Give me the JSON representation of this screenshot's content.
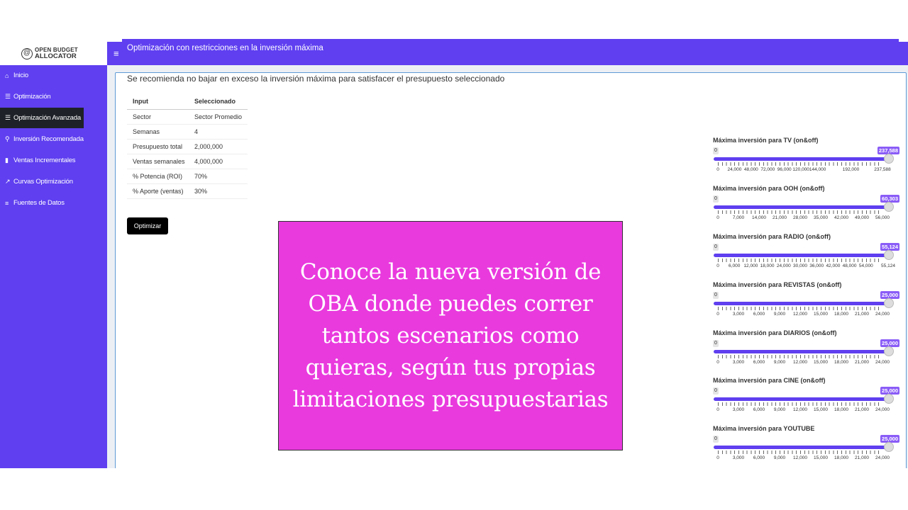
{
  "sidebar": {
    "logo_line1": "OPEN BUDGET",
    "logo_line2": "ALLOCATOR",
    "items": [
      {
        "label": "Inicio",
        "icon": "home-icon"
      },
      {
        "label": "Optimización",
        "icon": "sliders-icon"
      },
      {
        "label": "Optimización Avanzada",
        "icon": "sliders-icon"
      },
      {
        "label": "Inversión Recomendada",
        "icon": "search-icon"
      },
      {
        "label": "Ventas Incrementales",
        "icon": "bar-chart-icon"
      },
      {
        "label": "Curvas Optimización",
        "icon": "line-chart-icon"
      },
      {
        "label": "Fuentes de Datos",
        "icon": "database-icon"
      }
    ],
    "active_item": "Optimización Avanzada"
  },
  "header": {
    "menu_icon": "hamburger-icon"
  },
  "main": {
    "box_title": "Optimización con restricciones en la inversión máxima",
    "recommendation": "Se recomienda no bajar en exceso la inversión máxima para satisfacer el presupuesto seleccionado",
    "table": {
      "headers": [
        "Input",
        "Seleccionado"
      ],
      "rows": [
        [
          "Sector",
          "Sector Promedio"
        ],
        [
          "Semanas",
          "4"
        ],
        [
          "Presupuesto total",
          "2,000,000"
        ],
        [
          "Ventas semanales",
          "4,000,000"
        ],
        [
          "% Potencia (ROI)",
          "70%"
        ],
        [
          "% Aporte (ventas)",
          "30%"
        ]
      ]
    },
    "optimize_button": "Optimizar"
  },
  "sliders": [
    {
      "label": "Máxima inversión para TV (on&off)",
      "min": "0",
      "value": "237,588",
      "level": 1.0,
      "ticks": [
        "0",
        "24,000",
        "48,000",
        "72,000",
        "96,000",
        "120,000",
        "144,000",
        "192,000",
        "237,588"
      ]
    },
    {
      "label": "Máxima inversión para OOH (on&off)",
      "min": "0",
      "value": "60,303",
      "level": 1.0,
      "ticks": [
        "0",
        "7,000",
        "14,000",
        "21,000",
        "28,000",
        "35,000",
        "42,000",
        "49,000",
        "56,000"
      ]
    },
    {
      "label": "Máxima inversión para RADIO (on&off)",
      "min": "0",
      "value": "55,124",
      "level": 1.0,
      "ticks": [
        "0",
        "6,000",
        "12,000",
        "18,000",
        "24,000",
        "30,000",
        "36,000",
        "42,000",
        "48,000",
        "54,000",
        "55,124"
      ]
    },
    {
      "label": "Máxima inversión para REVISTAS (on&off)",
      "min": "0",
      "value": "25,000",
      "level": 1.0,
      "ticks": [
        "0",
        "3,000",
        "6,000",
        "9,000",
        "12,000",
        "15,000",
        "18,000",
        "21,000",
        "24,000"
      ]
    },
    {
      "label": "Máxima inversión para DIARIOS (on&off)",
      "min": "0",
      "value": "25,000",
      "level": 1.0,
      "ticks": [
        "0",
        "3,000",
        "6,000",
        "9,000",
        "12,000",
        "15,000",
        "18,000",
        "21,000",
        "24,000"
      ]
    },
    {
      "label": "Máxima inversión para CINE (on&off)",
      "min": "0",
      "value": "25,000",
      "level": 1.0,
      "ticks": [
        "0",
        "3,000",
        "6,000",
        "9,000",
        "12,000",
        "15,000",
        "18,000",
        "21,000",
        "24,000"
      ]
    },
    {
      "label": "Máxima inversión para YOUTUBE",
      "min": "0",
      "value": "25,000",
      "level": 1.0,
      "ticks": [
        "0",
        "3,000",
        "6,000",
        "9,000",
        "12,000",
        "15,000",
        "18,000",
        "21,000",
        "24,000"
      ]
    }
  ],
  "promo": {
    "text": "Conoce la nueva versión de OBA donde puedes correr tantos escenarios como quieras, según tus propias limitaciones presupuestarias"
  },
  "colors": {
    "brand": "#5f3ff0",
    "active_nav": "#1e2228",
    "promo_bg": "#e93ade",
    "slider_tag": "#8a5cf7"
  }
}
